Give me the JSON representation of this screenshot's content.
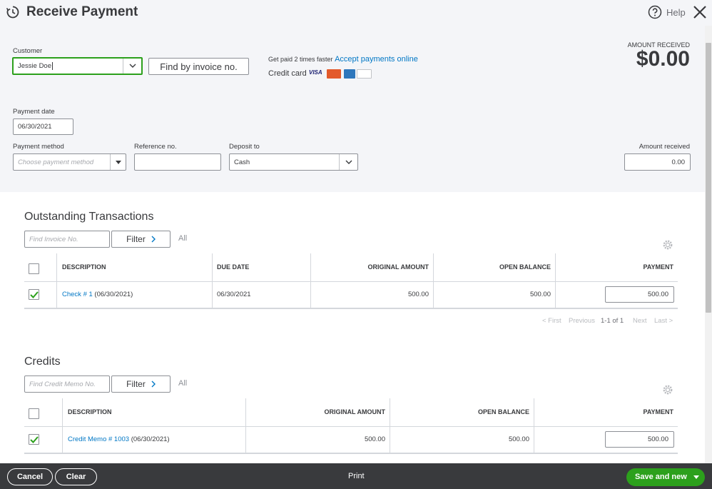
{
  "header": {
    "title": "Receive Payment",
    "help_label": "Help"
  },
  "customer": {
    "label": "Customer",
    "value": "Jessie Doe"
  },
  "find_invoice_label": "Find by invoice no.",
  "promo": {
    "prefix": "Get paid 2 times faster",
    "link": "Accept payments online",
    "credit_card_label": "Credit card"
  },
  "amount_received_header": {
    "label": "AMOUNT RECEIVED",
    "value": "$0.00"
  },
  "payment_date": {
    "label": "Payment date",
    "value": "06/30/2021"
  },
  "payment_method": {
    "label": "Payment method",
    "placeholder": "Choose payment method"
  },
  "reference": {
    "label": "Reference no.",
    "value": ""
  },
  "deposit_to": {
    "label": "Deposit to",
    "value": "Cash"
  },
  "amount_received_field": {
    "label": "Amount received",
    "value": "0.00"
  },
  "outstanding": {
    "title": "Outstanding Transactions",
    "search_placeholder": "Find Invoice No.",
    "filter_label": "Filter",
    "all_label": "All",
    "columns": [
      "DESCRIPTION",
      "DUE DATE",
      "ORIGINAL AMOUNT",
      "OPEN BALANCE",
      "PAYMENT"
    ],
    "rows": [
      {
        "link": "Check # 1",
        "date_suffix": " (06/30/2021)",
        "due_date": "06/30/2021",
        "original": "500.00",
        "open": "500.00",
        "payment": "500.00",
        "checked": true
      }
    ],
    "pager": {
      "first": "< First",
      "previous": "Previous",
      "range": "1-1 of 1",
      "next": "Next",
      "last": "Last >"
    }
  },
  "credits": {
    "title": "Credits",
    "search_placeholder": "Find Credit Memo No.",
    "filter_label": "Filter",
    "all_label": "All",
    "columns": [
      "DESCRIPTION",
      "ORIGINAL AMOUNT",
      "OPEN BALANCE",
      "PAYMENT"
    ],
    "rows": [
      {
        "link": "Credit Memo # 1003",
        "date_suffix": " (06/30/2021)",
        "original": "500.00",
        "open": "500.00",
        "payment": "500.00",
        "checked": true
      }
    ]
  },
  "footer": {
    "cancel": "Cancel",
    "clear": "Clear",
    "print": "Print",
    "save_new": "Save and new"
  },
  "colors": {
    "accent_green": "#2ca01c",
    "link_blue": "#0077c5",
    "footer_bg": "#393a3d",
    "panel_bg": "#f4f5f8"
  }
}
